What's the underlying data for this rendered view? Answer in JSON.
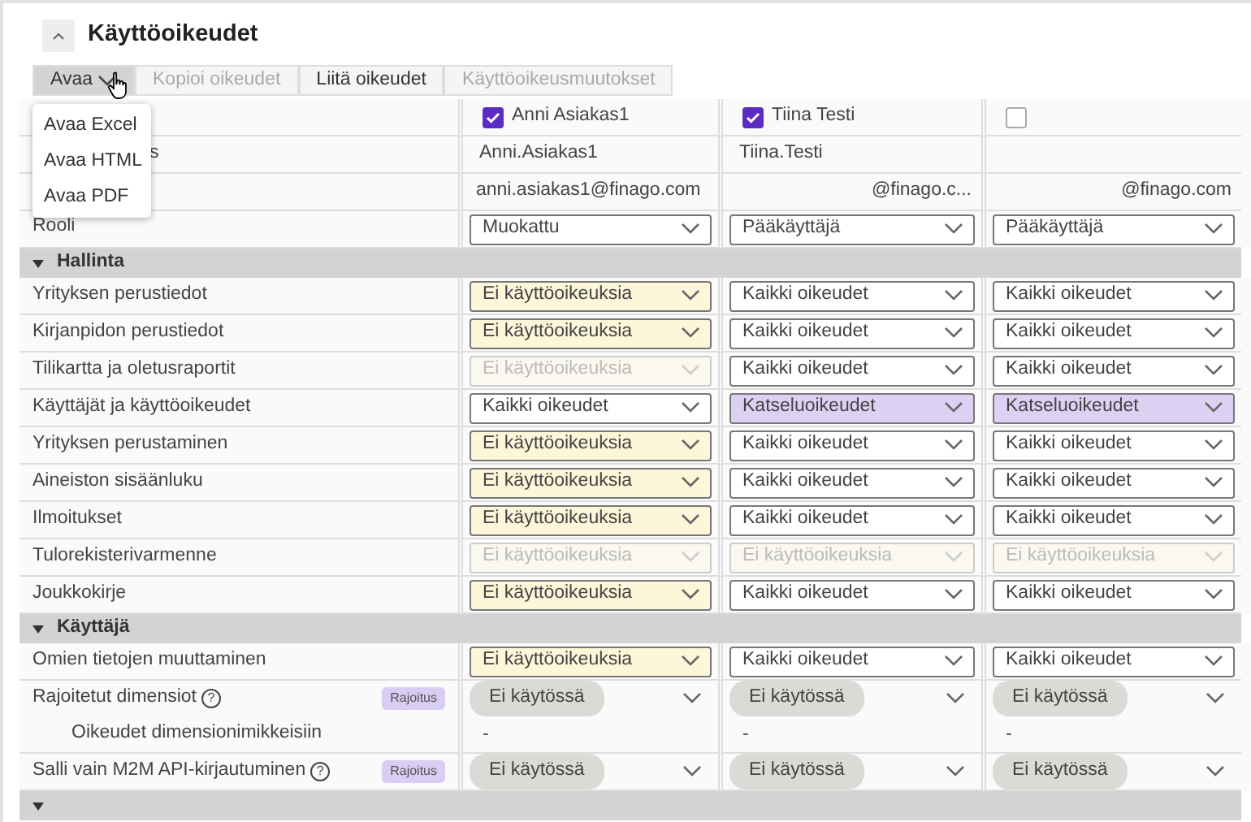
{
  "section": {
    "title": "Käyttöoikeudet",
    "expanded": true
  },
  "toolbar": [
    {
      "label": "Avaa",
      "kind": "dropdown",
      "disabled": false,
      "pressed": true
    },
    {
      "label": "Kopioi oikeudet",
      "kind": "button",
      "disabled": true,
      "pressed": false
    },
    {
      "label": "Liitä oikeudet",
      "kind": "button",
      "disabled": false,
      "pressed": false
    },
    {
      "label": "Käyttöoikeusmuutokset",
      "kind": "button",
      "disabled": true,
      "pressed": false
    }
  ],
  "open_menu": [
    "Avaa Excel",
    "Avaa HTML",
    "Avaa PDF"
  ],
  "header_labels": {
    "username_label": "s",
    "role_label": "Rooli"
  },
  "users": [
    {
      "name": "Anni Asiakas1",
      "checked": true,
      "username": "Anni.Asiakas1",
      "email": "anni.asiakas1@finago.com",
      "role": "Muokattu"
    },
    {
      "name": "Tiina Testi",
      "checked": true,
      "username": "Tiina.Testi",
      "email": "@finago.c...",
      "role": "Pääkäyttäjä"
    },
    {
      "checked": false,
      "email": "@finago.com",
      "role": "Pääkäyttäjä"
    }
  ],
  "groups": [
    {
      "title": "Hallinta",
      "expanded": true,
      "rows": [
        {
          "label": "Yrityksen perustiedot",
          "kind": "select",
          "cells": [
            {
              "value": "Ei käyttöoikeuksia",
              "color": "#fdf6d8",
              "disabled": false
            },
            {
              "value": "Kaikki oikeudet",
              "color": "#ffffff",
              "disabled": false
            },
            {
              "value": "Kaikki oikeudet",
              "color": "#ffffff",
              "disabled": false
            }
          ]
        },
        {
          "label": "Kirjanpidon perustiedot",
          "kind": "select",
          "cells": [
            {
              "value": "Ei käyttöoikeuksia",
              "color": "#fdf6d8",
              "disabled": false
            },
            {
              "value": "Kaikki oikeudet",
              "color": "#ffffff",
              "disabled": false
            },
            {
              "value": "Kaikki oikeudet",
              "color": "#ffffff",
              "disabled": false
            }
          ]
        },
        {
          "label": "Tilikartta ja oletusraportit",
          "kind": "select",
          "cells": [
            {
              "value": "Ei käyttöoikeuksia",
              "color": "#faf8ef",
              "disabled": true
            },
            {
              "value": "Kaikki oikeudet",
              "color": "#ffffff",
              "disabled": false
            },
            {
              "value": "Kaikki oikeudet",
              "color": "#ffffff",
              "disabled": false
            }
          ]
        },
        {
          "label": "Käyttäjät ja käyttöoikeudet",
          "kind": "select",
          "cells": [
            {
              "value": "Kaikki oikeudet",
              "color": "#ffffff",
              "disabled": false
            },
            {
              "value": "Katseluoikeudet",
              "color": "#dcd1f3",
              "disabled": false
            },
            {
              "value": "Katseluoikeudet",
              "color": "#dcd1f3",
              "disabled": false
            }
          ]
        },
        {
          "label": "Yrityksen perustaminen",
          "kind": "select",
          "cells": [
            {
              "value": "Ei käyttöoikeuksia",
              "color": "#fdf6d8",
              "disabled": false
            },
            {
              "value": "Kaikki oikeudet",
              "color": "#ffffff",
              "disabled": false
            },
            {
              "value": "Kaikki oikeudet",
              "color": "#ffffff",
              "disabled": false
            }
          ]
        },
        {
          "label": "Aineiston sisäänluku",
          "kind": "select",
          "cells": [
            {
              "value": "Ei käyttöoikeuksia",
              "color": "#fdf6d8",
              "disabled": false
            },
            {
              "value": "Kaikki oikeudet",
              "color": "#ffffff",
              "disabled": false
            },
            {
              "value": "Kaikki oikeudet",
              "color": "#ffffff",
              "disabled": false
            }
          ]
        },
        {
          "label": "Ilmoitukset",
          "kind": "select",
          "cells": [
            {
              "value": "Ei käyttöoikeuksia",
              "color": "#fdf6d8",
              "disabled": false
            },
            {
              "value": "Kaikki oikeudet",
              "color": "#ffffff",
              "disabled": false
            },
            {
              "value": "Kaikki oikeudet",
              "color": "#ffffff",
              "disabled": false
            }
          ]
        },
        {
          "label": "Tulorekisterivarmenne",
          "kind": "select",
          "cells": [
            {
              "value": "Ei käyttöoikeuksia",
              "color": "#faf8ef",
              "disabled": true
            },
            {
              "value": "Ei käyttöoikeuksia",
              "color": "#faf8ef",
              "disabled": true
            },
            {
              "value": "Ei käyttöoikeuksia",
              "color": "#faf8ef",
              "disabled": true
            }
          ]
        },
        {
          "label": "Joukkokirje",
          "kind": "select",
          "cells": [
            {
              "value": "Ei käyttöoikeuksia",
              "color": "#fdf6d8",
              "disabled": false
            },
            {
              "value": "Kaikki oikeudet",
              "color": "#ffffff",
              "disabled": false
            },
            {
              "value": "Kaikki oikeudet",
              "color": "#ffffff",
              "disabled": false
            }
          ]
        }
      ]
    },
    {
      "title": "Käyttäjä",
      "expanded": true,
      "rows": [
        {
          "label": "Omien tietojen muuttaminen",
          "kind": "select",
          "cells": [
            {
              "value": "Ei käyttöoikeuksia",
              "color": "#fdf6d8",
              "disabled": false
            },
            {
              "value": "Kaikki oikeudet",
              "color": "#ffffff",
              "disabled": false
            },
            {
              "value": "Kaikki oikeudet",
              "color": "#ffffff",
              "disabled": false
            }
          ]
        },
        {
          "label": "Rajoitetut dimensiot",
          "kind": "toggle",
          "help": "?",
          "badge": "Rajoitus",
          "cells": [
            {
              "value": "Ei käytössä"
            },
            {
              "value": "Ei käytössä"
            },
            {
              "value": "Ei käytössä"
            }
          ],
          "sub_label": "Oikeudet dimensionimikkeisiin",
          "sub_values": [
            "-",
            "-",
            "-"
          ]
        },
        {
          "label": "Salli vain M2M API-kirjautuminen",
          "kind": "toggle",
          "help": "?",
          "badge": "Rajoitus",
          "cells": [
            {
              "value": "Ei käytössä"
            },
            {
              "value": "Ei käytössä"
            },
            {
              "value": "Ei käytössä"
            }
          ]
        }
      ]
    },
    {
      "expanded": true
    }
  ]
}
